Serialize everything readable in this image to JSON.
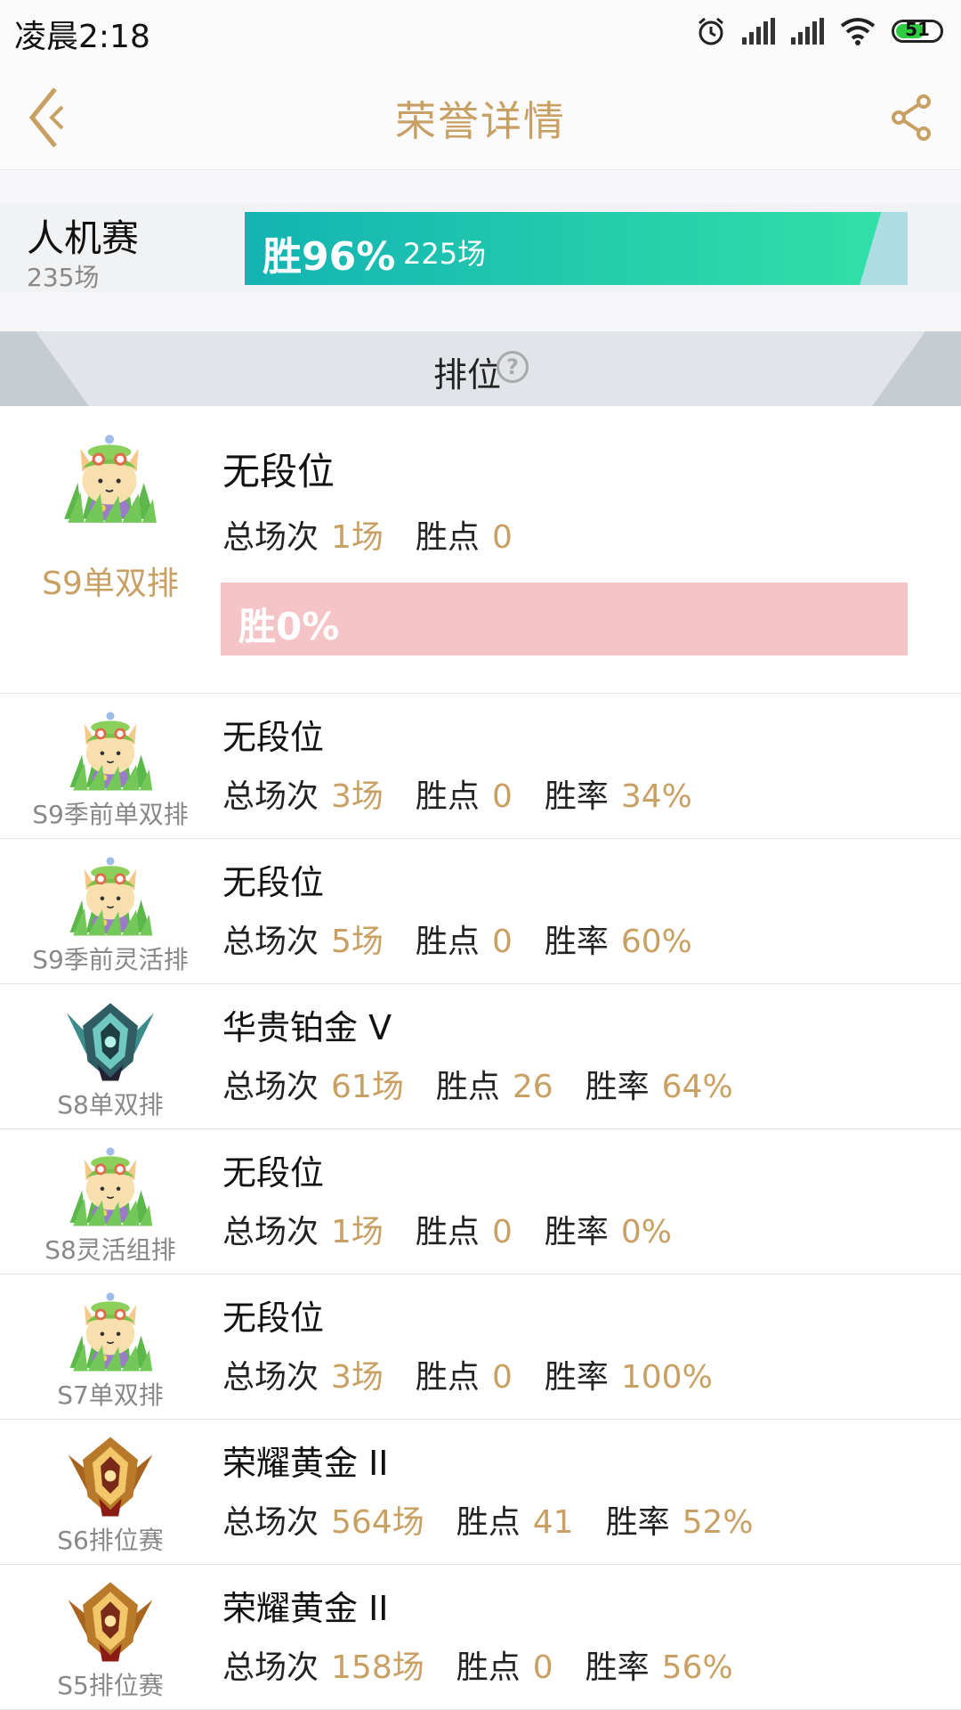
{
  "status_bar": {
    "time": "凌晨2:18",
    "battery": "51",
    "icons": [
      "alarm-icon",
      "signal-icon",
      "signal-icon",
      "wifi-icon",
      "battery-icon"
    ]
  },
  "header": {
    "title": "荣誉详情",
    "back_icon": "back-icon",
    "share_icon": "share-icon"
  },
  "bot_match": {
    "title": "人机赛",
    "total": "235场",
    "win_label": "胜96%",
    "win_matches": "225场",
    "win_fraction": 0.96,
    "color": "#1cc0ae"
  },
  "ranked": {
    "title": "排位",
    "help_icon": "help-icon"
  },
  "labels": {
    "total": "总场次",
    "points": "胜点",
    "rate": "胜率"
  },
  "seasons": [
    {
      "season": "S9单双排",
      "rank": "无段位",
      "total": "1场",
      "points": "0",
      "win_label": "胜0%",
      "badge": "teemo-avatar"
    },
    {
      "season": "S9季前单双排",
      "rank": "无段位",
      "total": "3场",
      "points": "0",
      "rate": "34%",
      "badge": "teemo-avatar"
    },
    {
      "season": "S9季前灵活排",
      "rank": "无段位",
      "total": "5场",
      "points": "0",
      "rate": "60%",
      "badge": "teemo-avatar"
    },
    {
      "season": "S8单双排",
      "rank": "华贵铂金 V",
      "total": "61场",
      "points": "26",
      "rate": "64%",
      "badge": "platinum-badge"
    },
    {
      "season": "S8灵活组排",
      "rank": "无段位",
      "total": "1场",
      "points": "0",
      "rate": "0%",
      "badge": "teemo-avatar"
    },
    {
      "season": "S7单双排",
      "rank": "无段位",
      "total": "3场",
      "points": "0",
      "rate": "100%",
      "badge": "teemo-avatar"
    },
    {
      "season": "S6排位赛",
      "rank": "荣耀黄金 II",
      "total": "564场",
      "points": "41",
      "rate": "52%",
      "badge": "gold-badge"
    },
    {
      "season": "S5排位赛",
      "rank": "荣耀黄金 II",
      "total": "158场",
      "points": "0",
      "rate": "56%",
      "badge": "gold-badge"
    }
  ]
}
